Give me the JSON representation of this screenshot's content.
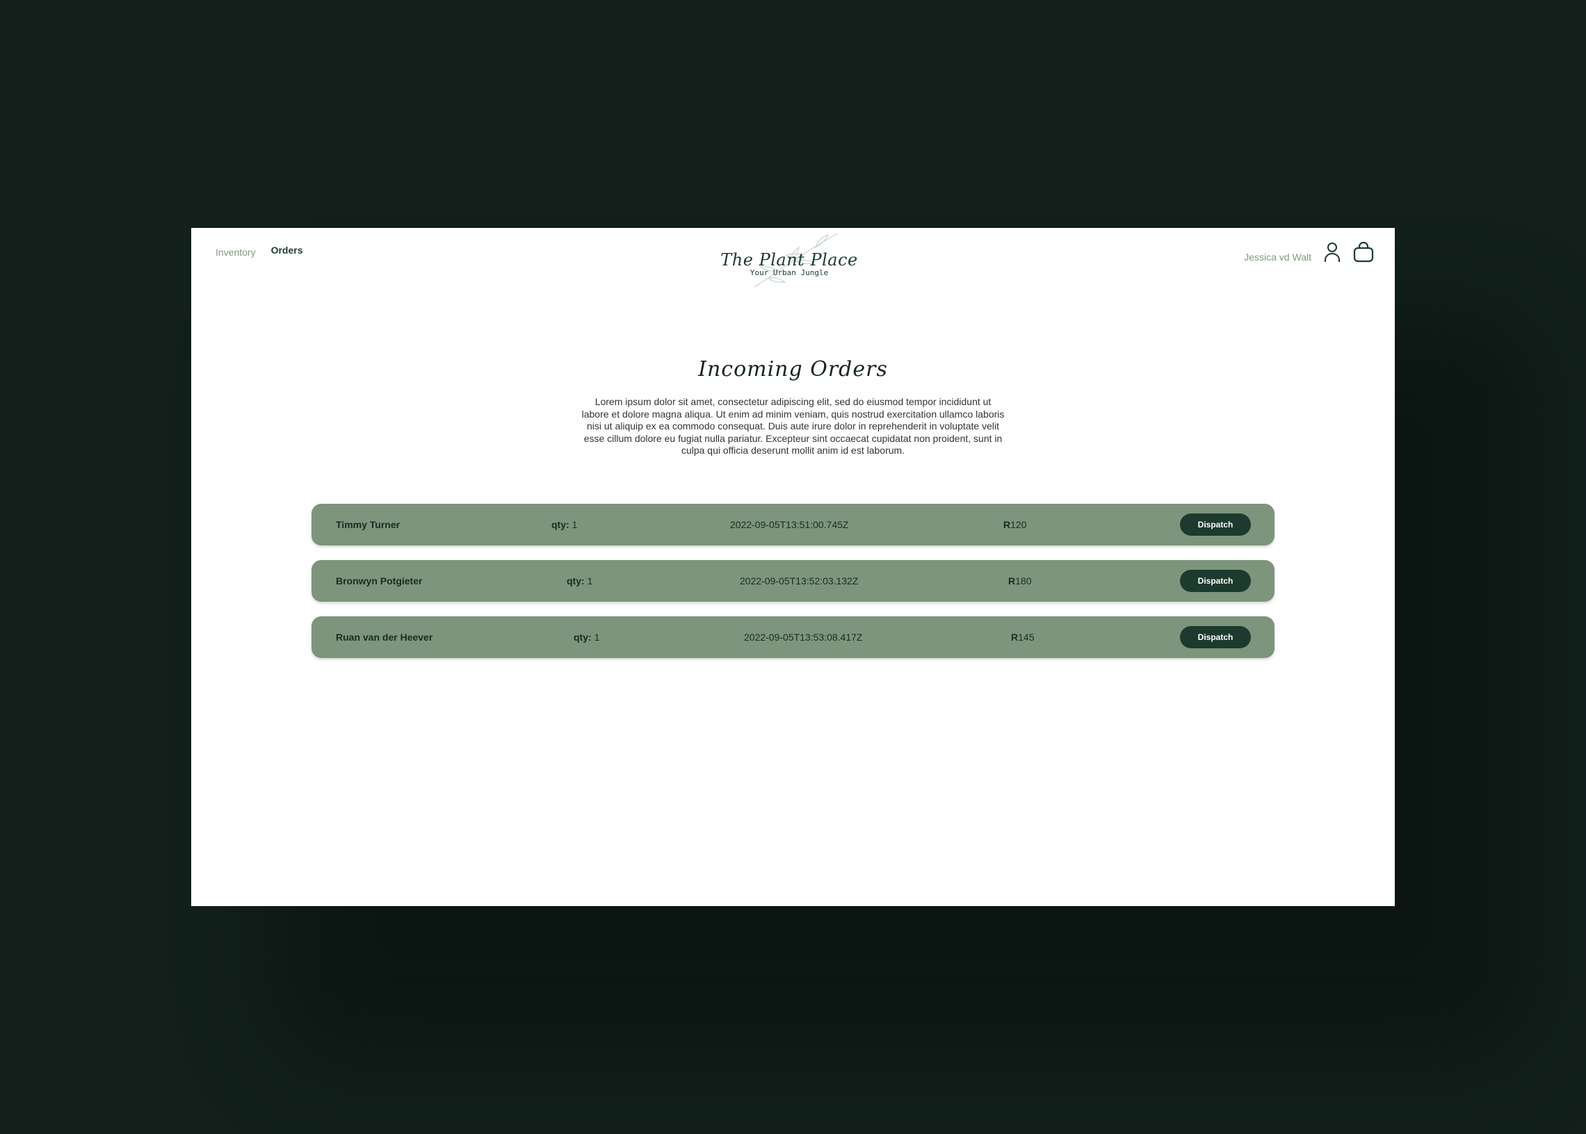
{
  "nav": {
    "links": [
      {
        "label": "Inventory",
        "active": false
      },
      {
        "label": "Orders",
        "active": true
      }
    ]
  },
  "brand": {
    "title": "The Plant Place",
    "tagline": "Your Urban Jungle"
  },
  "user": {
    "name": "Jessica vd Walt"
  },
  "icons": {
    "profile": "user-icon",
    "cart": "shopping-bag-icon"
  },
  "page": {
    "title": "Incoming Orders",
    "description": "Lorem ipsum dolor sit amet, consectetur adipiscing elit, sed do eiusmod tempor incididunt ut labore et dolore magna aliqua. Ut enim ad minim veniam, quis nostrud exercitation ullamco laboris nisi ut aliquip ex ea commodo consequat. Duis aute irure dolor in reprehenderit in voluptate velit esse cillum dolore eu fugiat nulla pariatur. Excepteur sint occaecat cupidatat non proident, sunt in culpa qui officia deserunt mollit anim id est laborum."
  },
  "orders": [
    {
      "customer": "Timmy Turner",
      "qty_label": "qty:",
      "qty": "1",
      "timestamp": "2022-09-05T13:51:00.745Z",
      "currency": "R",
      "amount": "120",
      "action": "Dispatch"
    },
    {
      "customer": "Bronwyn Potgieter",
      "qty_label": "qty:",
      "qty": "1",
      "timestamp": "2022-09-05T13:52:03.132Z",
      "currency": "R",
      "amount": "180",
      "action": "Dispatch"
    },
    {
      "customer": "Ruan van der Heever",
      "qty_label": "qty:",
      "qty": "1",
      "timestamp": "2022-09-05T13:53:08.417Z",
      "currency": "R",
      "amount": "145",
      "action": "Dispatch"
    }
  ],
  "colors": {
    "background": "#121f1b",
    "row": "#7d957c",
    "accent": "#1d3a2e",
    "muted_text": "#7d9a7e"
  }
}
